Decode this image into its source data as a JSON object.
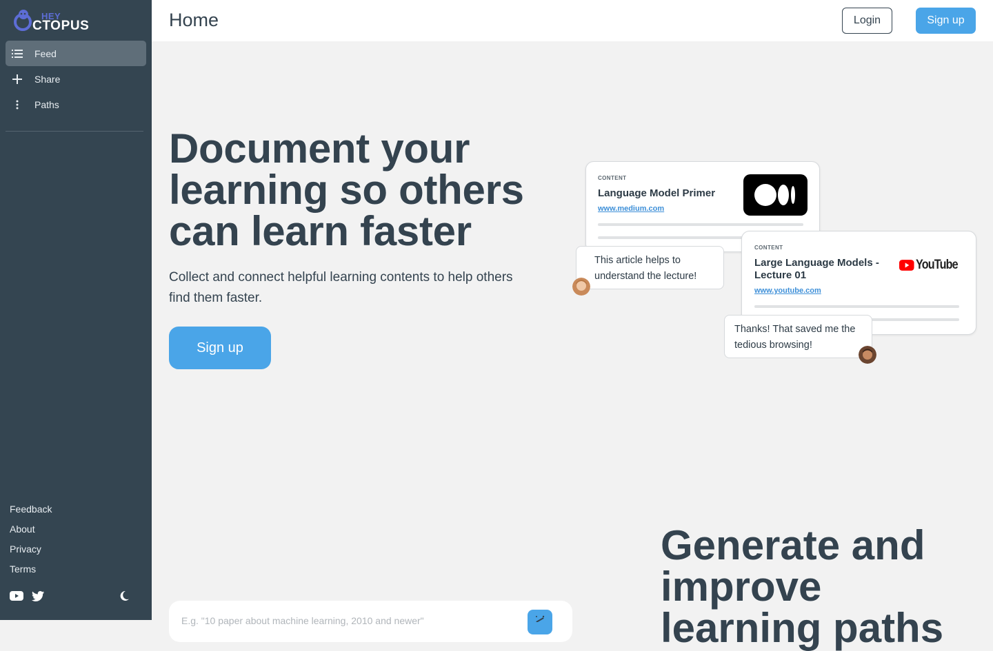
{
  "brand": {
    "hey": "HEY",
    "ctopus": "CTOPUS"
  },
  "sidebar": {
    "items": [
      {
        "label": "Feed",
        "icon": "list-icon",
        "active": true
      },
      {
        "label": "Share",
        "icon": "plus-icon",
        "active": false
      },
      {
        "label": "Paths",
        "icon": "dots-vertical-icon",
        "active": false
      }
    ],
    "footer_links": [
      "Feedback",
      "About",
      "Privacy",
      "Terms"
    ],
    "social_icons": [
      "youtube-icon",
      "twitter-icon"
    ],
    "theme_toggle_icon": "moon-icon"
  },
  "header": {
    "title": "Home",
    "login_label": "Login",
    "signup_label": "Sign up"
  },
  "hero": {
    "title": "Document your learning so others can learn faster",
    "subtitle": "Collect and connect helpful learning contents to help others find them faster.",
    "cta_label": "Sign up"
  },
  "illustration": {
    "card1": {
      "tag": "CONTENT",
      "title": "Language Model Primer",
      "link": "www.medium.com",
      "logo": "medium-logo"
    },
    "bubble1": "This article helps to understand the lecture!",
    "card2": {
      "tag": "CONTENT",
      "title": "Large Language Models - Lecture 01",
      "link": "www.youtube.com",
      "logo": "youtube-logo",
      "logo_text": "YouTube"
    },
    "bubble2": "Thanks! That saved me the tedious browsing!"
  },
  "section2": {
    "title": "Generate and improve learning paths"
  },
  "prompt": {
    "placeholder": "E.g. \"10 paper about machine learning, 2010 and newer\"",
    "submit_icon": "magic-wand-icon"
  },
  "colors": {
    "sidebar_bg": "#344551",
    "accent": "#4aa5e8",
    "text": "#34434f",
    "page_bg": "#f2f2f2"
  }
}
